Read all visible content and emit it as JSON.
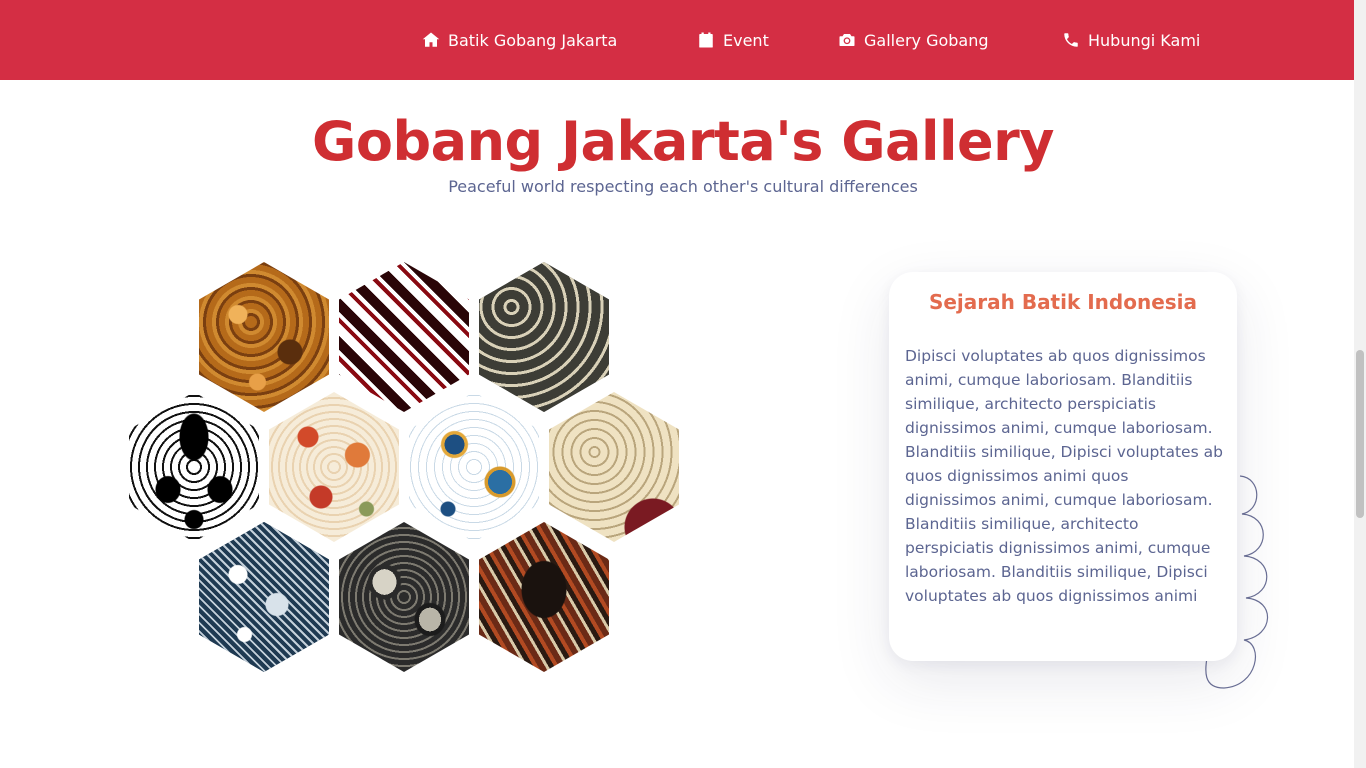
{
  "nav": {
    "items": [
      {
        "label": "Batik Gobang Jakarta",
        "icon": "home-icon"
      },
      {
        "label": "Event",
        "icon": "calendar-icon"
      },
      {
        "label": "Gallery Gobang",
        "icon": "camera-icon"
      },
      {
        "label": "Hubungi Kami",
        "icon": "phone-icon"
      }
    ]
  },
  "header": {
    "title": "Gobang Jakarta's Gallery",
    "subtitle": "Peaceful world respecting each other's cultural differences"
  },
  "gallery": {
    "tiles": [
      {
        "pattern": "brown-paisley"
      },
      {
        "pattern": "red-diagonal-parang"
      },
      {
        "pattern": "gray-kawung-s"
      },
      {
        "pattern": "black-white-damask"
      },
      {
        "pattern": "cream-red-floral"
      },
      {
        "pattern": "blue-gold-floral"
      },
      {
        "pattern": "cream-maroon-paisley"
      },
      {
        "pattern": "navy-white-floral"
      },
      {
        "pattern": "dark-gray-paisley"
      },
      {
        "pattern": "brown-bird-motif"
      }
    ]
  },
  "card": {
    "title": "Sejarah Batik Indonesia",
    "body": "Dipisci voluptates ab quos dignissimos animi, cumque laboriosam. Blanditiis similique, architecto perspiciatis dignissimos animi, cumque laboriosam. Blanditiis similique, Dipisci voluptates ab quos dignissimos animi quos dignissimos animi, cumque laboriosam. Blanditiis similique, architecto perspiciatis dignissimos animi, cumque laboriosam. Blanditiis similique, Dipisci voluptates ab quos dignissimos animi"
  },
  "colors": {
    "navbar": "#d42e44",
    "title": "#cf2e32",
    "subtitle": "#5c6591",
    "card_title": "#e36b4e"
  }
}
